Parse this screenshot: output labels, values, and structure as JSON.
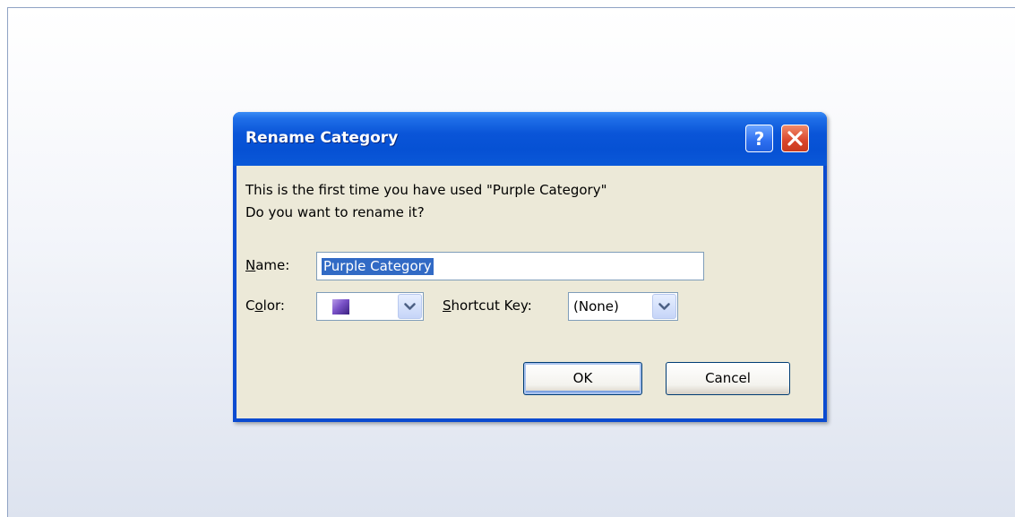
{
  "dialog": {
    "title": "Rename Category",
    "message_line1": "This is the first time you have used \"Purple Category\"",
    "message_line2": "Do you want to rename it?",
    "name_label_mnemonic": "N",
    "name_label_rest": "ame:",
    "name_value": "Purple Category",
    "color_label_first": "C",
    "color_label_mnemonic": "o",
    "color_label_rest": "lor:",
    "color_value": "purple",
    "shortcut_label_mnemonic": "S",
    "shortcut_label_rest": "hortcut Key:",
    "shortcut_value": "(None)",
    "ok_label": "OK",
    "cancel_label": "Cancel"
  },
  "icons": {
    "help": "help-icon",
    "close": "close-icon",
    "dropdown": "chevron-down-icon"
  },
  "colors": {
    "titlebar": "#0a55d8",
    "dialog_body": "#ece9d8",
    "selection": "#316ac5",
    "close_button": "#d9452b",
    "help_button": "#2d6ff0"
  }
}
